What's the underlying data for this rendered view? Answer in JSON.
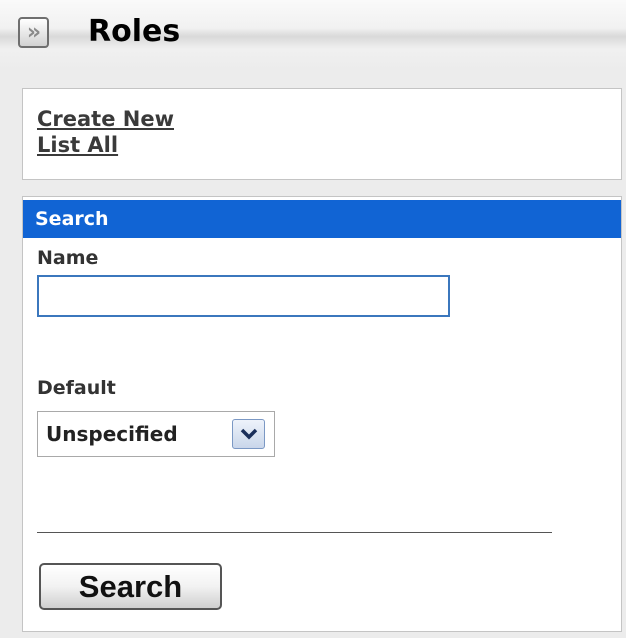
{
  "header": {
    "title": "Roles",
    "collapse_icon": "double-chevron-right-icon",
    "collapse_glyph": "»"
  },
  "links": {
    "create_new": "Create New",
    "list_all": "List All"
  },
  "search": {
    "section_title": "Search",
    "name_label": "Name",
    "name_value": "",
    "default_label": "Default",
    "default_selected": "Unspecified",
    "dropdown_icon": "chevron-down-icon",
    "button_label": "Search"
  },
  "colors": {
    "section_bar": "#1164d4",
    "input_border": "#3b77bd"
  }
}
